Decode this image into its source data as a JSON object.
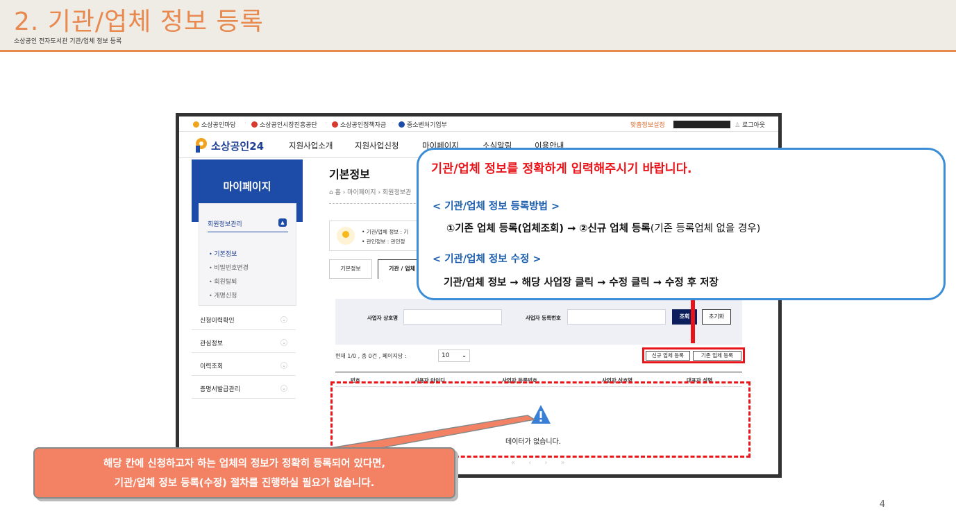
{
  "slide": {
    "title": "2. 기관/업체 정보 등록",
    "subtitle": "소상공인 전자도서관 기관/업체 정보 등록",
    "page_number": "4"
  },
  "topbar": {
    "links": [
      "소상공인마당",
      "소상공인시장진흥공단",
      "소상공인정책자금",
      "중소벤처기업부"
    ],
    "fit_setting": "맞춤정보설정",
    "logout": "로그아웃"
  },
  "gnb": {
    "logo": "소상공인24",
    "menu": [
      "지원사업소개",
      "지원사업신청",
      "마이페이지",
      "소식알림",
      "이용안내"
    ]
  },
  "sidebar": {
    "title": "마이페이지",
    "section": "회원정보관리",
    "sub_items": [
      "기본정보",
      "비밀번호변경",
      "회원탈퇴",
      "개명신청"
    ],
    "menus": [
      "신청이력확인",
      "관심정보",
      "이력조회",
      "증명서발급관리"
    ]
  },
  "content": {
    "title": "기본정보",
    "breadcrumb": "홈 › 마이페이지 › 회원정보관",
    "notice_1": "• 기관/업체 정보 : 기",
    "notice_2": "• 관인정보 : 관인정",
    "tabs": [
      "기본정보",
      "기관 / 업체"
    ]
  },
  "search": {
    "biz_name_label": "사업자 상호명",
    "biz_no_label": "사업자 등록번호",
    "search_btn": "조회",
    "reset_btn": "초기화"
  },
  "list": {
    "status": "현재 1/0 , 총 0건 , 페이지당 :",
    "per_page": "10",
    "new_btn": "신규 업체 등록",
    "existing_btn": "기존 업체 등록",
    "columns": [
      "번호",
      "사용자 아이디",
      "사업자 등록번호",
      "사업자 상호명",
      "대표자 성명"
    ],
    "empty": "데이터가 없습니다.",
    "pager": "« ‹ › »"
  },
  "callout": {
    "heading": "기관/업체 정보를 정확하게 입력해주시기 바랍니다.",
    "section1": "< 기관/업체 정보 등록방법 >",
    "line1_bold": "①기존 업체 등록(업체조회) → ②신규 업체 등록",
    "line1_normal": "(기존 등록업체 없을 경우)",
    "section2": "< 기관/업체 정보 수정 >",
    "line2": "기관/업체 정보 → 해당 사업장 클릭 → 수정 클릭 → 수정 후 저장"
  },
  "note": {
    "line1": "해당 칸에 신청하고자 하는 업체의 정보가 정확히 등록되어 있다면,",
    "line2": "기관/업체 정보 등록(수정) 절차를 진행하실 필요가 없습니다."
  },
  "colors": {
    "accent_orange": "#e8894f",
    "brand_blue": "#1c4ba8",
    "alert_red": "#e8141a",
    "callout_blue": "#3a8dd6",
    "note_orange": "#f28263"
  }
}
